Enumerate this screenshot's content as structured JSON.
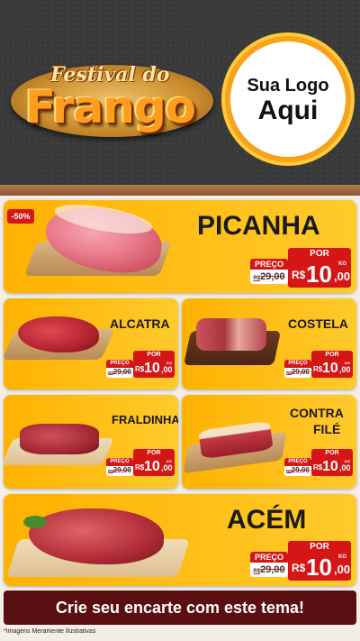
{
  "header": {
    "festival_script": "Festival do",
    "festival_title": "Frango",
    "logo_line1": "Sua Logo",
    "logo_line2": "Aqui"
  },
  "badge": "-50%",
  "labels": {
    "por": "POR",
    "preco": "PREÇO",
    "currency": "R$",
    "unit": "KG"
  },
  "products": [
    {
      "name": "PICANHA",
      "old_price": "29,00",
      "price_int": "10",
      "price_cents": ",00"
    },
    {
      "name": "ALCATRA",
      "old_price": "29,00",
      "price_int": "10",
      "price_cents": ",00"
    },
    {
      "name": "COSTELA",
      "old_price": "29,00",
      "price_int": "10",
      "price_cents": ",00"
    },
    {
      "name": "FRALDINHA",
      "old_price": "29,00",
      "price_int": "10",
      "price_cents": ",00"
    },
    {
      "name_line1": "CONTRA",
      "name_line2": "FILÉ",
      "old_price": "29,00",
      "price_int": "10",
      "price_cents": ",00"
    },
    {
      "name": "ACÉM",
      "old_price": "29,00",
      "price_int": "10",
      "price_cents": ",00"
    }
  ],
  "cta": "Crie seu encarte com este tema!",
  "disclaimer": "*Imagens Meramente Ilustrativas",
  "colors": {
    "accent_red": "#d51616",
    "card_orange": "#ffb200",
    "cta_bg": "#5a0f12",
    "header_bg": "#3a3a3a"
  }
}
